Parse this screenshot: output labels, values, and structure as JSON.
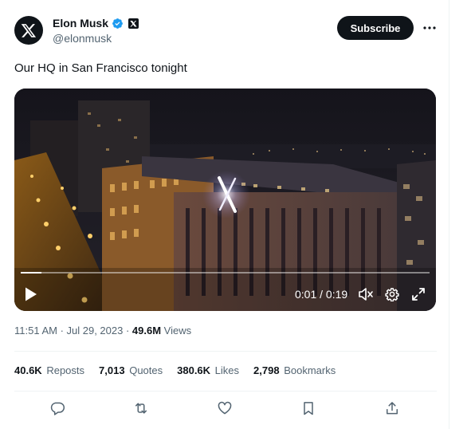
{
  "author": {
    "display_name": "Elon Musk",
    "handle": "@elonmusk",
    "avatar_icon": "x-logo-icon",
    "verified_icon": "verified-badge-icon",
    "affiliate_icon": "x-affiliate-badge-icon"
  },
  "header": {
    "subscribe_label": "Subscribe",
    "more_icon": "more-horizontal-icon"
  },
  "tweet": {
    "text": "Our HQ in San Francisco tonight"
  },
  "video": {
    "time_display": "0:01 / 0:19",
    "progress": 0.05,
    "controls": [
      "play-icon",
      "mute-icon",
      "settings-icon",
      "fullscreen-icon"
    ]
  },
  "meta": {
    "timestamp": "11:51 AM · Jul 29, 2023 · ",
    "views_count": "49.6M",
    "views_label": " Views"
  },
  "stats": {
    "reposts_count": "40.6K",
    "reposts_label": "Reposts",
    "quotes_count": "7,013",
    "quotes_label": "Quotes",
    "likes_count": "380.6K",
    "likes_label": "Likes",
    "bookmarks_count": "2,798",
    "bookmarks_label": "Bookmarks"
  },
  "actions": [
    "reply-icon",
    "repost-icon",
    "like-icon",
    "bookmark-icon",
    "share-icon"
  ],
  "colors": {
    "text_primary": "#0f1419",
    "text_secondary": "#536471",
    "verified_blue": "#1d9bf0",
    "divider": "#eff3f4"
  }
}
